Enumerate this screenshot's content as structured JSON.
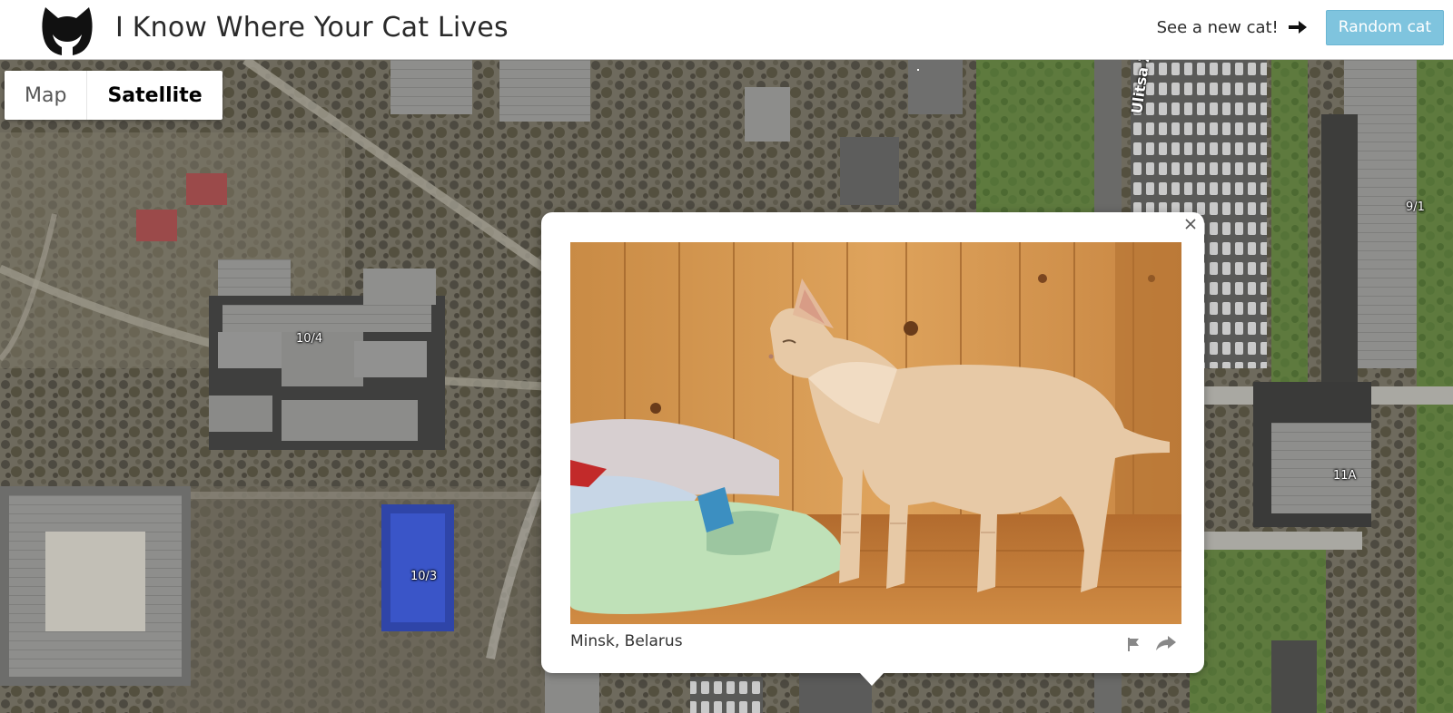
{
  "header": {
    "title": "I Know Where Your Cat Lives",
    "new_cat_text": "See a new cat!",
    "random_button": "Random cat",
    "logo_icon": "cat-head-icon",
    "arrow_icon": "arrow-right-icon",
    "button_color": "#7fc4de"
  },
  "map": {
    "type_options": [
      "Map",
      "Satellite"
    ],
    "selected_type": "Satellite",
    "building_labels": [
      "10/4",
      "10/3",
      "9/1",
      "11A"
    ],
    "road_label": "Ulitsa Z"
  },
  "popup": {
    "location": "Minsk, Belarus",
    "close_icon": "close-icon",
    "flag_icon": "flag-icon",
    "share_icon": "share-icon"
  }
}
